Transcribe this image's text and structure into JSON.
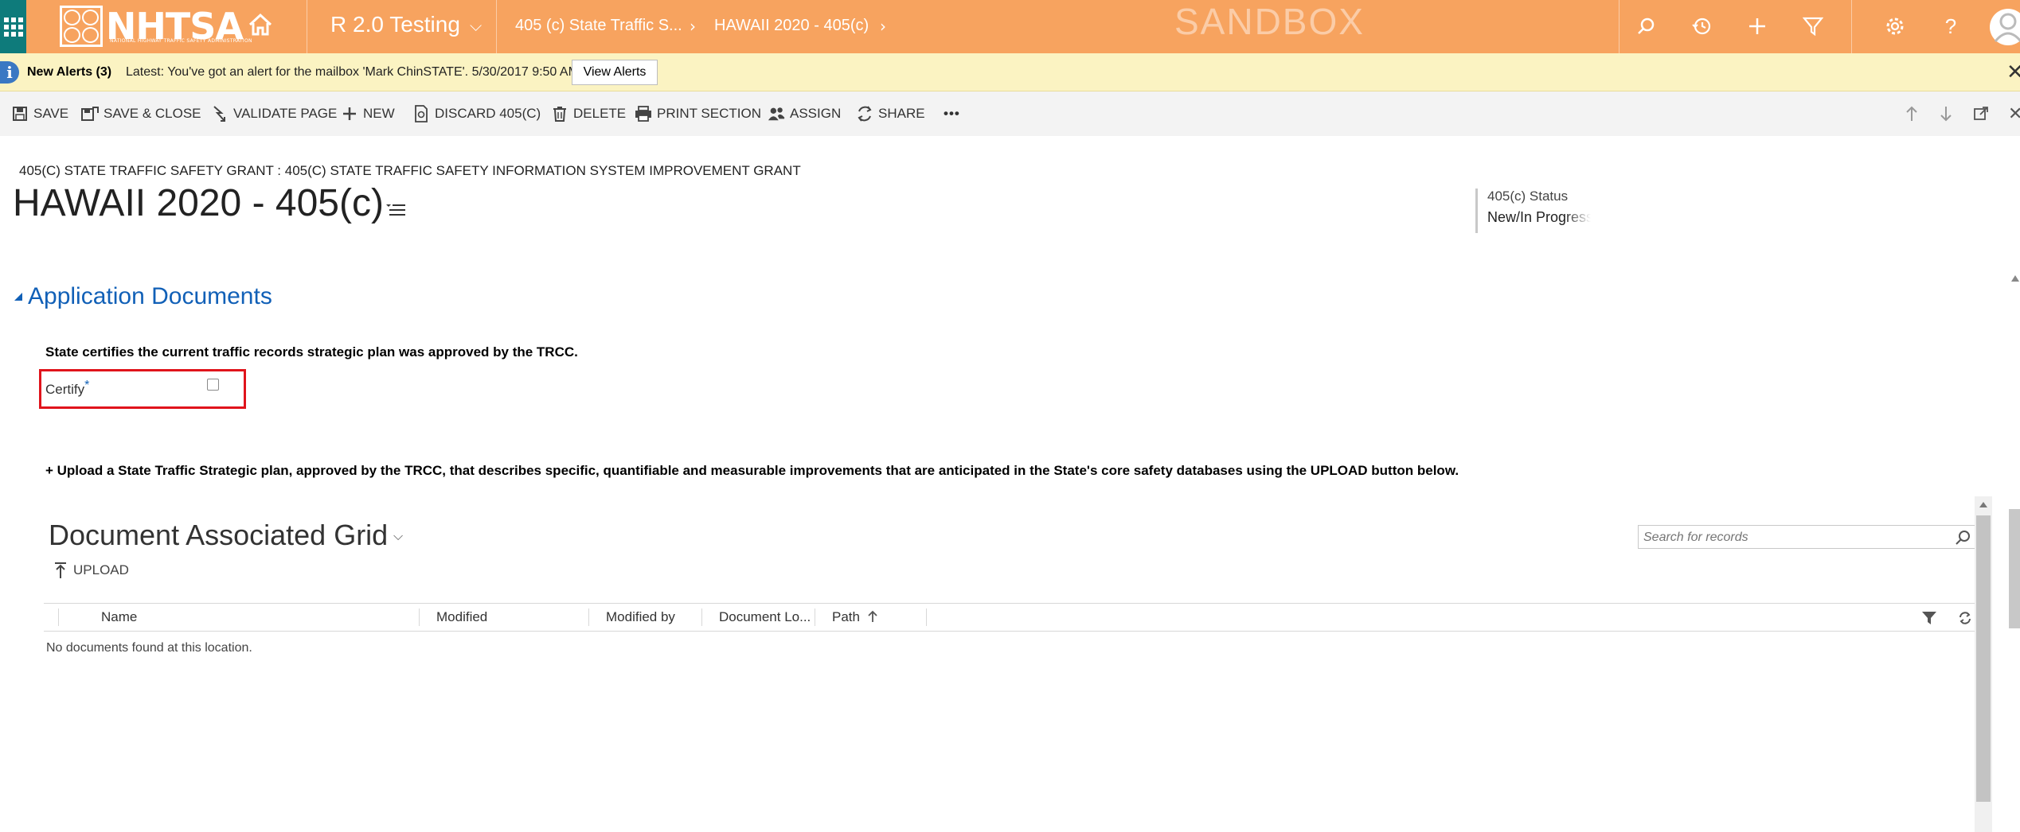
{
  "nav": {
    "logo_text": "NHTSA",
    "logo_subtext": "NATIONAL HIGHWAY TRAFFIC SAFETY ADMINISTRATION",
    "app_name": "R 2.0 Testing",
    "crumb_1": "405 (c) State Traffic S...",
    "crumb_2": "HAWAII 2020 - 405(c)",
    "environment_label": "SANDBOX",
    "icons": [
      "waffle-icon",
      "home-icon",
      "search-icon",
      "recent-icon",
      "add-icon",
      "filter-icon",
      "settings-icon",
      "help-icon",
      "user-avatar-icon"
    ]
  },
  "alert": {
    "title": "New Alerts (3)",
    "message": "Latest: You've got an alert for the mailbox 'Mark ChinSTATE'. 5/30/2017 9:50 AM",
    "button_label": "View Alerts"
  },
  "commands": {
    "save": "SAVE",
    "save_close": "SAVE & CLOSE",
    "validate": "VALIDATE PAGE",
    "new": "NEW",
    "discard": "DISCARD 405(C)",
    "delete": "DELETE",
    "print": "PRINT SECTION",
    "assign": "ASSIGN",
    "share": "SHARE",
    "more": "•••"
  },
  "record": {
    "breadcrumb": "405(C) STATE TRAFFIC SAFETY GRANT : 405(C) STATE TRAFFIC SAFETY INFORMATION SYSTEM IMPROVEMENT GRANT",
    "title": "HAWAII 2020 - 405(c)",
    "status_label": "405(c) Status",
    "status_value": "New/In Progress"
  },
  "section": {
    "title": "Application Documents",
    "certify_instruction": "State certifies the current traffic records strategic plan was approved by the TRCC.",
    "certify_label": "Certify",
    "required_marker": "*",
    "certify_checked": false,
    "upload_instruction": "+ Upload a State Traffic Strategic plan, approved by the TRCC, that describes specific, quantifiable and measurable improvements that are anticipated in the State's core safety databases using the UPLOAD button below."
  },
  "grid": {
    "title": "Document Associated Grid",
    "search_placeholder": "Search for records",
    "upload_label": "UPLOAD",
    "columns": [
      "Name",
      "Modified",
      "Modified by",
      "Document Lo...",
      "Path"
    ],
    "sort_column": "Path",
    "empty_message": "No documents found at this location."
  },
  "colors": {
    "nav_bg": "#f7a35f",
    "waffle_bg": "#0e7b7b",
    "alert_bg": "#fbf3c2",
    "accent_blue": "#1160b7",
    "highlight_red": "#e0141c"
  }
}
